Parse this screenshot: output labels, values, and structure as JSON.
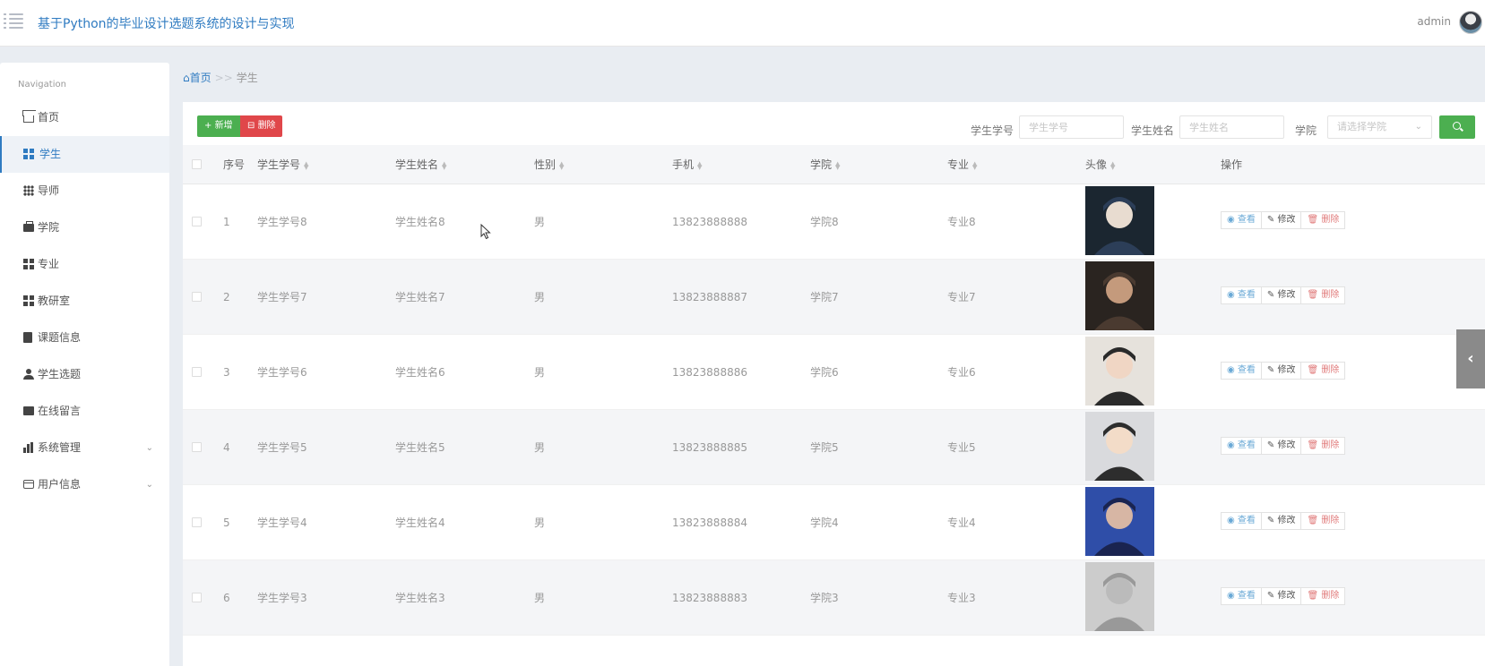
{
  "header": {
    "title": "基于Python的毕业设计选题系统的设计与实现",
    "user": "admin"
  },
  "sidebar": {
    "caption": "Navigation",
    "items": [
      {
        "label": "首页",
        "icon": "home-icon"
      },
      {
        "label": "学生",
        "icon": "grid-icon",
        "active": true
      },
      {
        "label": "导师",
        "icon": "grid-dots-icon"
      },
      {
        "label": "学院",
        "icon": "briefcase-icon"
      },
      {
        "label": "专业",
        "icon": "grid-icon"
      },
      {
        "label": "教研室",
        "icon": "grid-icon"
      },
      {
        "label": "课题信息",
        "icon": "clipboard-icon"
      },
      {
        "label": "学生选题",
        "icon": "user-icon"
      },
      {
        "label": "在线留言",
        "icon": "ticket-icon"
      },
      {
        "label": "系统管理",
        "icon": "bar-chart-icon",
        "expandable": true
      },
      {
        "label": "用户信息",
        "icon": "card-icon",
        "expandable": true
      }
    ]
  },
  "breadcrumb": {
    "home": "首页",
    "separator": ">>",
    "current": "学生"
  },
  "toolbar": {
    "add_label": "新增",
    "delete_label": "删除",
    "search": {
      "student_no_label": "学生学号",
      "student_no_placeholder": "学生学号",
      "student_name_label": "学生姓名",
      "student_name_placeholder": "学生姓名",
      "college_label": "学院",
      "college_placeholder": "请选择学院"
    }
  },
  "table": {
    "headers": {
      "index": "序号",
      "student_no": "学生学号",
      "student_name": "学生姓名",
      "gender": "性别",
      "phone": "手机",
      "college": "学院",
      "major": "专业",
      "photo": "头像",
      "actions": "操作"
    },
    "action_labels": {
      "view": "查看",
      "edit": "修改",
      "delete": "删除"
    },
    "rows": [
      {
        "index": "1",
        "student_no": "学生学号8",
        "student_name": "学生姓名8",
        "gender": "男",
        "phone": "13823888888",
        "college": "学院8",
        "major": "专业8"
      },
      {
        "index": "2",
        "student_no": "学生学号7",
        "student_name": "学生姓名7",
        "gender": "男",
        "phone": "13823888887",
        "college": "学院7",
        "major": "专业7"
      },
      {
        "index": "3",
        "student_no": "学生学号6",
        "student_name": "学生姓名6",
        "gender": "男",
        "phone": "13823888886",
        "college": "学院6",
        "major": "专业6"
      },
      {
        "index": "4",
        "student_no": "学生学号5",
        "student_name": "学生姓名5",
        "gender": "男",
        "phone": "13823888885",
        "college": "学院5",
        "major": "专业5"
      },
      {
        "index": "5",
        "student_no": "学生学号4",
        "student_name": "学生姓名4",
        "gender": "男",
        "phone": "13823888884",
        "college": "学院4",
        "major": "专业4"
      },
      {
        "index": "6",
        "student_no": "学生学号3",
        "student_name": "学生姓名3",
        "gender": "男",
        "phone": "13823888883",
        "college": "学院3",
        "major": "专业3"
      }
    ]
  },
  "colors": {
    "accent": "#2f7bc1",
    "add": "#4caf50",
    "delete": "#e0474a",
    "search": "#4caf50"
  }
}
